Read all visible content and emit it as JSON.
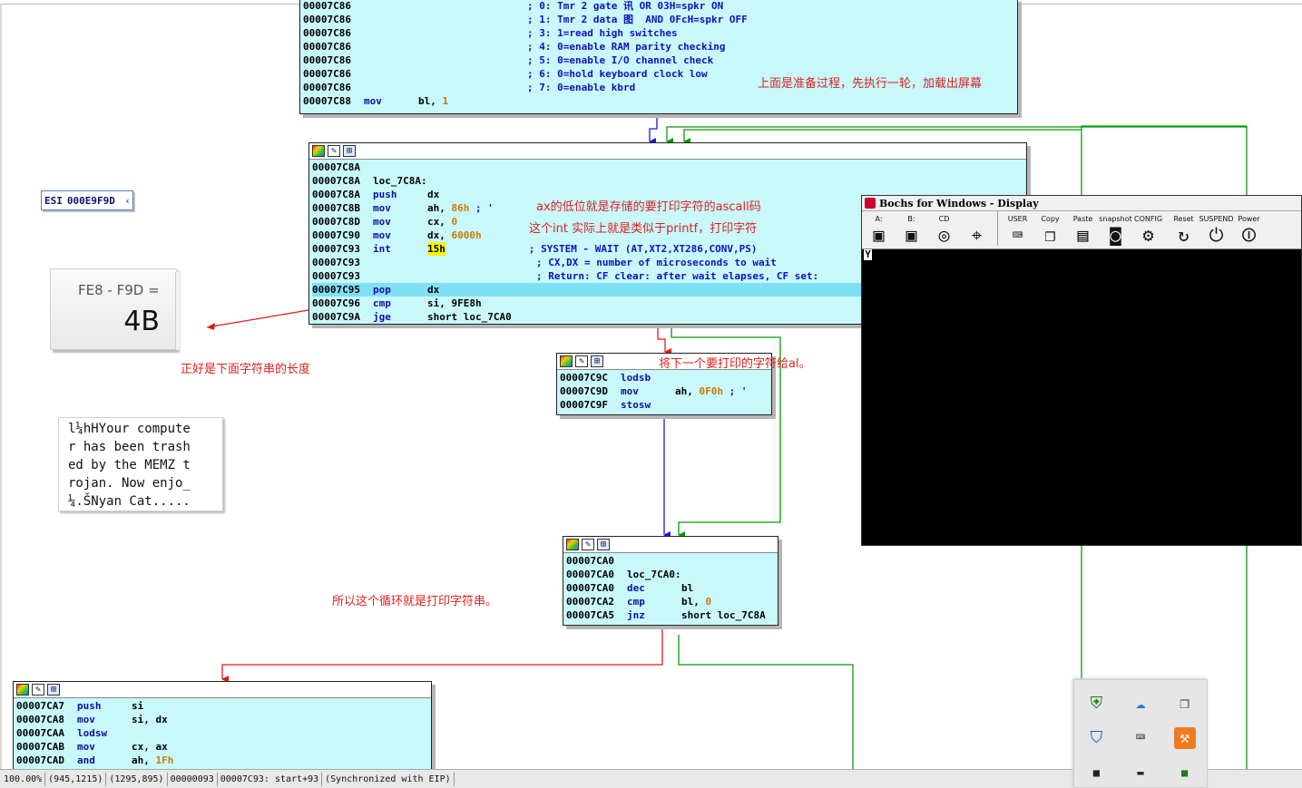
{
  "graph": {
    "edge_colors": {
      "unconditional": "#1818e0",
      "true": "#0a9a0a",
      "false": "#e01a1a"
    },
    "blocks": [
      {
        "lines": [
          {
            "address": "00007C86",
            "comment": "; 0: Tmr 2 gate 讯 OR 03H=spkr ON"
          },
          {
            "address": "00007C86",
            "comment": "; 1: Tmr 2 data 图  AND 0FcH=spkr OFF"
          },
          {
            "address": "00007C86",
            "comment": "; 3: 1=read high switches"
          },
          {
            "address": "00007C86",
            "comment": "; 4: 0=enable RAM parity checking"
          },
          {
            "address": "00007C86",
            "comment": "; 5: 0=enable I/O channel check"
          },
          {
            "address": "00007C86",
            "comment": "; 6: 0=hold keyboard clock low"
          },
          {
            "address": "00007C86",
            "comment": "; 7: 0=enable kbrd"
          },
          {
            "address": "00007C88",
            "mnemonic": "mov",
            "operands": "bl, ",
            "num": "1"
          }
        ]
      },
      {
        "lines": [
          {
            "address": "00007C8A"
          },
          {
            "address": "00007C8A",
            "label": "loc_7C8A:"
          },
          {
            "address": "00007C8A",
            "mnemonic": "push",
            "operands": "dx"
          },
          {
            "address": "00007C8B",
            "mnemonic": "mov",
            "operands": "ah, ",
            "num": "86h",
            "comment": " ; '"
          },
          {
            "address": "00007C8D",
            "mnemonic": "mov",
            "operands": "cx, ",
            "num": "0"
          },
          {
            "address": "00007C90",
            "mnemonic": "mov",
            "operands": "dx, ",
            "num": "6000h"
          },
          {
            "address": "00007C93",
            "mnemonic": "int",
            "operands": "",
            "num": "15h",
            "comment": "; SYSTEM - WAIT (AT,XT2,XT286,CONV,PS)"
          },
          {
            "address": "00007C93",
            "comment": "; CX,DX = number of microseconds to wait"
          },
          {
            "address": "00007C93",
            "comment": "; Return: CF clear: after wait elapses, CF set:"
          },
          {
            "address": "00007C95",
            "mnemonic": "pop",
            "operands": "dx"
          },
          {
            "address": "00007C96",
            "mnemonic": "cmp",
            "operands": "si, 9FE8h"
          },
          {
            "address": "00007C9A",
            "mnemonic": "jge",
            "operands": "short loc_7CA0"
          }
        ]
      },
      {
        "lines": [
          {
            "address": "00007C9C",
            "mnemonic": "lodsb"
          },
          {
            "address": "00007C9D",
            "mnemonic": "mov",
            "operands": "ah, ",
            "num": "0F0h",
            "comment": " ; '"
          },
          {
            "address": "00007C9F",
            "mnemonic": "stosw"
          }
        ]
      },
      {
        "lines": [
          {
            "address": "00007CA0"
          },
          {
            "address": "00007CA0",
            "label": "loc_7CA0:"
          },
          {
            "address": "00007CA0",
            "mnemonic": "dec",
            "operands": "bl"
          },
          {
            "address": "00007CA2",
            "mnemonic": "cmp",
            "operands": "bl, ",
            "num": "0"
          },
          {
            "address": "00007CA5",
            "mnemonic": "jnz",
            "operands": "short loc_7C8A"
          }
        ]
      },
      {
        "lines": [
          {
            "address": "00007CA7",
            "mnemonic": "push",
            "operands": "si"
          },
          {
            "address": "00007CA8",
            "mnemonic": "mov",
            "operands": "si, dx"
          },
          {
            "address": "00007CAA",
            "mnemonic": "lodsw"
          },
          {
            "address": "00007CAB",
            "mnemonic": "mov",
            "operands": "cx, ax"
          },
          {
            "address": "00007CAD",
            "mnemonic": "and",
            "operands": "ah, ",
            "num": "1Fh"
          }
        ]
      }
    ]
  },
  "annotations": [
    "上面是准备过程，先执行一轮，加载出屏幕",
    "ax的低位就是存储的要打印字符的ascall码",
    "这个int 实际上就是类似于printf，打印字符",
    "正好是下面字符串的长度",
    "将下一个要打印的字符给al。",
    "所以这个循环就是打印字符串。"
  ],
  "esi": {
    "label": "ESI",
    "value": "000E9F9D"
  },
  "calculation": {
    "expression": "FE8 - F9D =",
    "result": "4B"
  },
  "string_display": {
    "lines": [
      "l¼hHYour compute",
      "r has been trash",
      "ed by the MEMZ t",
      "rojan. Now enjo_",
      "¼.ŠNyan Cat....."
    ]
  },
  "bochs": {
    "title": "Bochs for Windows - Display",
    "toolbar": {
      "group1": [
        {
          "label": "A:",
          "icon": "floppy-a-icon"
        },
        {
          "label": "B:",
          "icon": "floppy-b-icon"
        },
        {
          "label": "CD",
          "icon": "cdrom-icon"
        },
        {
          "label": "",
          "icon": "mouse-icon"
        }
      ],
      "group2": [
        {
          "label": "USER",
          "icon": "user-icon"
        },
        {
          "label": "Copy",
          "icon": "copy-icon"
        },
        {
          "label": "Paste",
          "icon": "paste-icon"
        },
        {
          "label": "snapshot",
          "icon": "snapshot-icon"
        },
        {
          "label": "CONFIG",
          "icon": "config-icon"
        }
      ],
      "group3": [
        {
          "label": "Reset",
          "icon": "reset-icon"
        },
        {
          "label": "SUSPEND",
          "icon": "suspend-icon"
        },
        {
          "label": "Power",
          "icon": "power-icon"
        }
      ]
    },
    "display": {
      "content": "Y"
    }
  },
  "status_bar": {
    "segments": [
      "100.00%",
      "(945,1215)",
      "(1295,895)",
      "00000093",
      "00007C93: start+93",
      "(Synchronized with EIP)"
    ]
  },
  "taskbar": {
    "icons": [
      "defender-shield-icon",
      "baidu-netdisk-icon",
      "window-manager-icon",
      "security-shield-icon",
      "input-method-icon",
      "office-app-icon"
    ]
  }
}
